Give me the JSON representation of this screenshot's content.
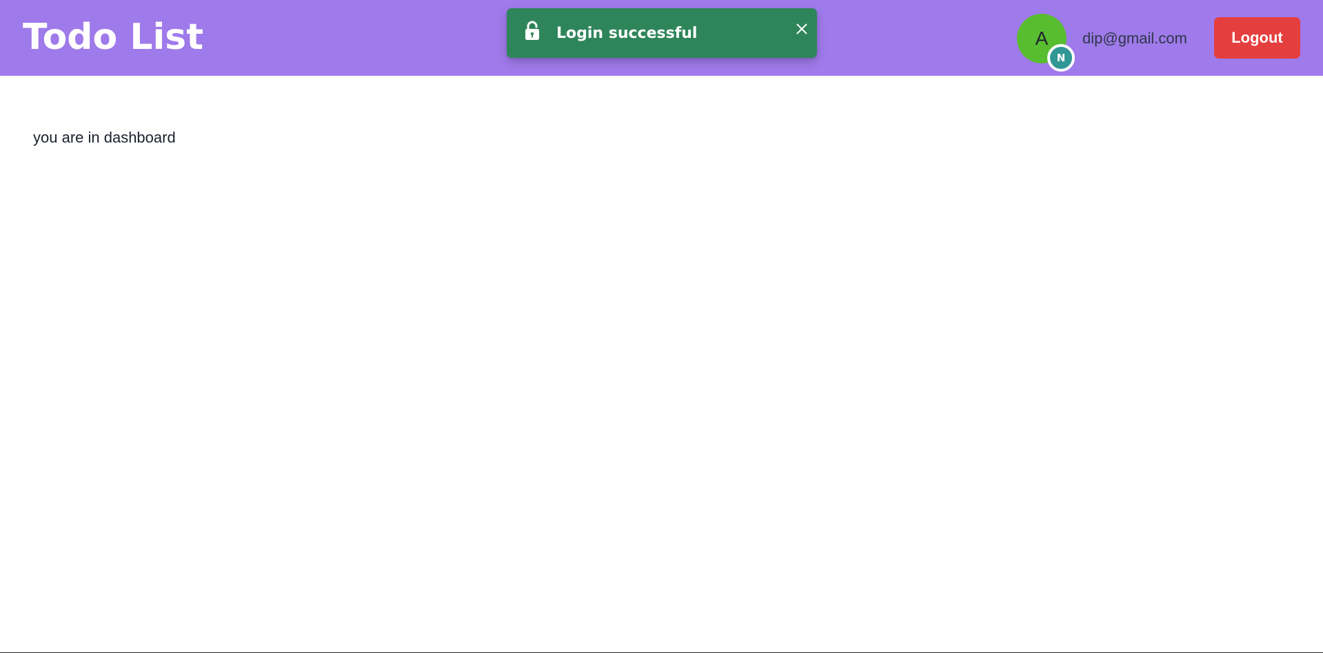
{
  "header": {
    "app_title": "Todo List",
    "background_color": "#9f7aea",
    "user": {
      "avatar_letter": "A",
      "avatar_color": "#58bd2f",
      "badge_letter": "N",
      "badge_color": "#319795",
      "email": "dip@gmail.com"
    },
    "logout_label": "Logout",
    "logout_color": "#e53e3e"
  },
  "toast": {
    "message": "Login successful",
    "status": "success",
    "background_color": "#2f855a",
    "icon": "unlock-icon",
    "close_icon": "close-icon"
  },
  "main": {
    "text": "you are in dashboard"
  }
}
